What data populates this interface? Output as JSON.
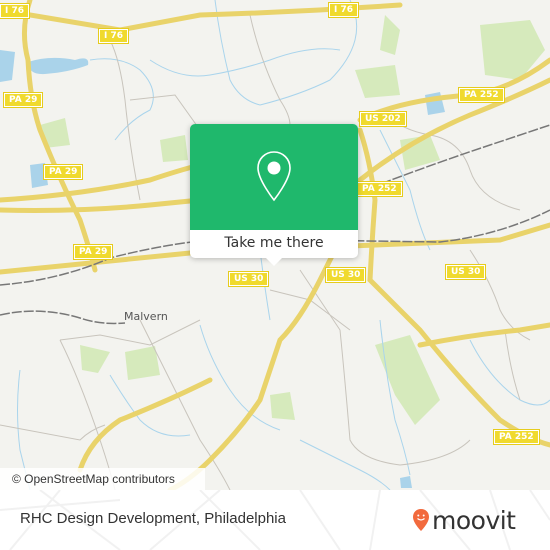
{
  "map": {
    "road_labels": [
      {
        "id": "i76-left",
        "text": "I 76"
      },
      {
        "id": "i76-mid",
        "text": "I 76"
      },
      {
        "id": "i76-right",
        "text": "I 76"
      },
      {
        "id": "pa29-top",
        "text": "PA 29"
      },
      {
        "id": "pa29-mid",
        "text": "PA 29"
      },
      {
        "id": "pa29-bottom",
        "text": "PA 29"
      },
      {
        "id": "us202",
        "text": "US 202"
      },
      {
        "id": "pa252-top",
        "text": "PA 252"
      },
      {
        "id": "pa252-mid",
        "text": "PA 252"
      },
      {
        "id": "pa252-bottom",
        "text": "PA 252"
      },
      {
        "id": "us30-left",
        "text": "US 30"
      },
      {
        "id": "us30-mid",
        "text": "US 30"
      },
      {
        "id": "us30-right",
        "text": "US 30"
      }
    ],
    "place_labels": [
      {
        "text": "Malvern"
      }
    ],
    "attribution": "© OpenStreetMap contributors",
    "colors": {
      "land": "#f3f3ef",
      "major_road": "#f5e27a",
      "water": "#aad3ea",
      "park": "#cfe8b0",
      "rail": "#777777"
    }
  },
  "popup": {
    "icon": "map-pin-icon",
    "button_label": "Take me there",
    "accent": "#1fb86c"
  },
  "footer": {
    "place_title": "RHC Design Development, Philadelphia",
    "logo_text": "moovit",
    "logo_icon": "moovit-pin-icon",
    "logo_color": "#f26a3d"
  }
}
